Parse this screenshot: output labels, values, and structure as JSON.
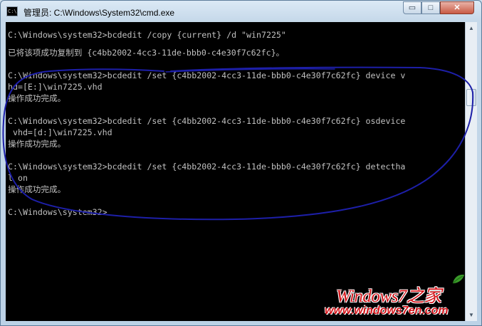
{
  "window": {
    "title": "管理员: C:\\Windows\\System32\\cmd.exe",
    "icon_label": "C:\\"
  },
  "controls": {
    "minimize": "▭",
    "maximize": "□",
    "close": "✕"
  },
  "console": {
    "lines": [
      "C:\\Windows\\system32>bcdedit /copy {current} /d \"win7225\"",
      "已将该项成功复制到 {c4bb2002-4cc3-11de-bbb0-c4e30f7c62fc}。",
      "",
      "C:\\Windows\\system32>bcdedit /set {c4bb2002-4cc3-11de-bbb0-c4e30f7c62fc} device v",
      "hd=[E:]\\win7225.vhd",
      "操作成功完成。",
      "",
      "C:\\Windows\\system32>bcdedit /set {c4bb2002-4cc3-11de-bbb0-c4e30f7c62fc} osdevice",
      " vhd=[d:]\\win7225.vhd",
      "操作成功完成。",
      "",
      "C:\\Windows\\system32>bcdedit /set {c4bb2002-4cc3-11de-bbb0-c4e30f7c62fc} detectha",
      "l on",
      "操作成功完成。",
      "",
      "C:\\Windows\\system32>"
    ]
  },
  "watermark": {
    "brand": "Windows7之家",
    "url": "www.windows7en.com"
  },
  "colors": {
    "console_bg": "#000000",
    "console_text": "#c0c0c0",
    "annotation": "#1d1fa8",
    "watermark": "#d3141a"
  }
}
